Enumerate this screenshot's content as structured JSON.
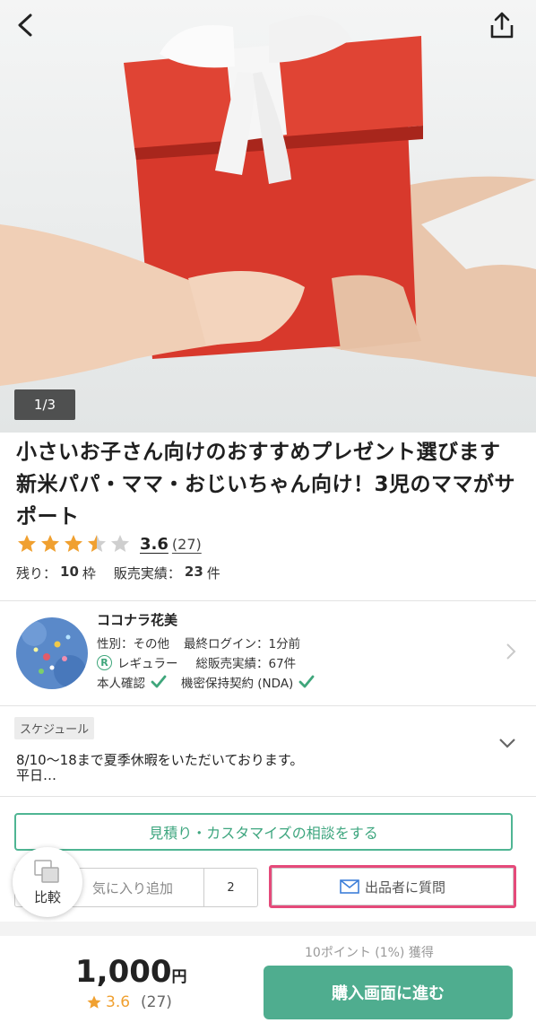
{
  "gallery": {
    "counter": "1/3"
  },
  "service": {
    "title": "小さいお子さん向けのおすすめプレゼント選びます 新米パパ・ママ・おじいちゃん向け！3児のママがサポート",
    "rating_value": "3.6",
    "rating_count": "(27)",
    "stars": [
      1,
      1,
      1,
      0.5,
      0
    ],
    "stock_label": "残り：",
    "stock_value": "10",
    "stock_unit": "枠",
    "sales_label": "販売実績：",
    "sales_value": "23",
    "sales_unit": "件"
  },
  "seller": {
    "name": "ココナラ花美",
    "gender": "性別：その他",
    "last_login": "最終ログイン：1分前",
    "rank_badge": "R",
    "rank": "レギュラー",
    "total_sales": "総販売実績：67件",
    "identity": "本人確認",
    "nda": "機密保持契約 (NDA)"
  },
  "schedule": {
    "tag": "スケジュール",
    "text": "8/10〜18まで夏季休暇をいただいております。\n平日…"
  },
  "actions": {
    "estimate": "見積り・カスタマイズの相談をする",
    "favorite": "気に入り追加",
    "favorite_count": "2",
    "ask": "出品者に質問",
    "compare": "比較"
  },
  "bottom": {
    "points": "10ポイント (1%) 獲得",
    "price": "1,000",
    "yen": "円",
    "rating_value": "3.6",
    "rating_count": "(27)",
    "buy": "購入画面に進む"
  },
  "colors": {
    "accent": "#4fad8f",
    "star": "#f0a030",
    "highlight": "#e54a7a"
  }
}
